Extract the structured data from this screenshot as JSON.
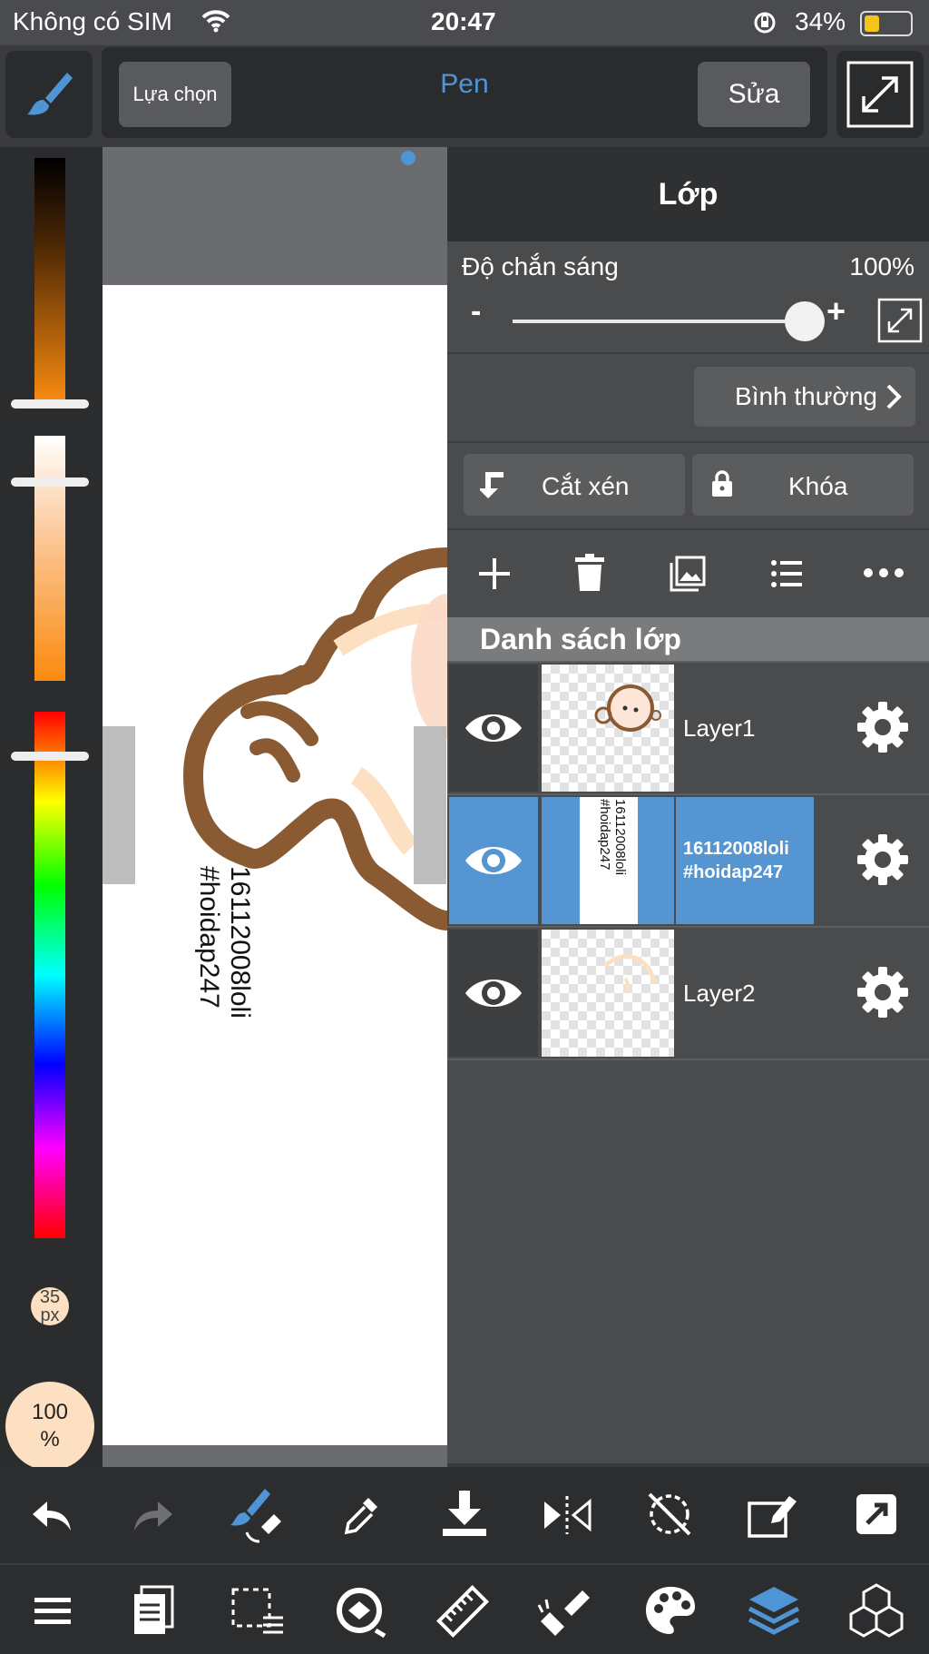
{
  "status_bar": {
    "carrier": "Không có SIM",
    "time": "20:47",
    "battery": "34%"
  },
  "toolbar": {
    "select_label": "Lựa chọn",
    "tool_name": "Pen",
    "edit_label": "Sửa"
  },
  "left_palette": {
    "brush_size": "35\npx",
    "opacity": "100\n%"
  },
  "canvas": {
    "text_line1": "16112008loli",
    "text_line2": "#hoidap247"
  },
  "layer_panel": {
    "title": "Lớp",
    "opacity_label": "Độ chắn sáng",
    "opacity_value": "100%",
    "opacity_fraction": 1.0,
    "minus": "-",
    "plus": "+",
    "blend_mode": "Bình thường",
    "clip_label": "Cắt xén",
    "lock_label": "Khóa",
    "list_header": "Danh sách lớp",
    "layers": [
      {
        "name": "Layer1",
        "selected": false
      },
      {
        "name": "16112008loli\n#hoidap247",
        "selected": true
      },
      {
        "name": "Layer2",
        "selected": false
      }
    ]
  },
  "colors": {
    "accent": "#4f95d6",
    "selected_row": "#5596d2",
    "brown_stroke": "#8a5a33"
  },
  "bottom_toolbar_1": [
    "undo-icon",
    "redo-icon",
    "brush-tool-icon",
    "eyedropper-icon",
    "download-icon",
    "flip-horizontal-icon",
    "rotate-disabled-icon",
    "edit-canvas-icon",
    "share-icon"
  ],
  "bottom_toolbar_2": [
    "menu-icon",
    "pages-icon",
    "selection-icon",
    "transform-icon",
    "ruler-icon",
    "fill-tool-icon",
    "palette-icon",
    "layers-icon",
    "materials-icon"
  ]
}
